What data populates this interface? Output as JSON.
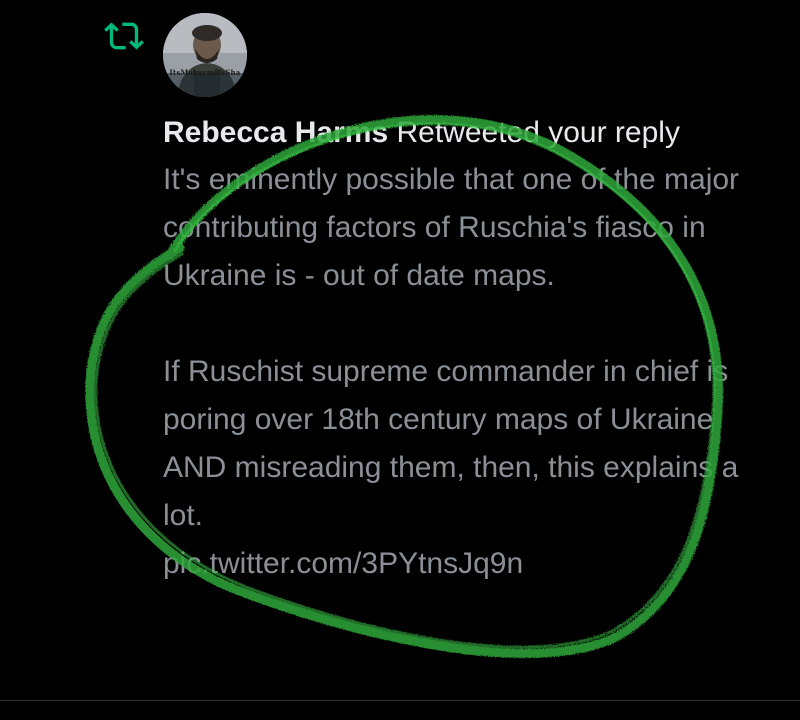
{
  "notification": {
    "type_icon": "retweet-icon",
    "avatar_text": "ItsMaksymDaSha",
    "user_name": "Rebecca Harms",
    "action_text": "Retweeted your reply",
    "tweet": {
      "paragraph1": "It's eminently possible that one of the major contributing factors of Ruschia's fiasco in Ukraine is - out of date maps.",
      "paragraph2": "If Ruschist supreme commander in chief is poring over 18th century maps of Ukraine AND misreading them, then, this explains a lot.",
      "link": "pic.twitter.com/3PYtnsJq9n"
    }
  },
  "colors": {
    "background": "#000000",
    "retweet_green": "#00ba7c",
    "primary_text": "#e7e9ea",
    "secondary_text": "#8b9096",
    "marker_circle": "#2fa83a"
  }
}
